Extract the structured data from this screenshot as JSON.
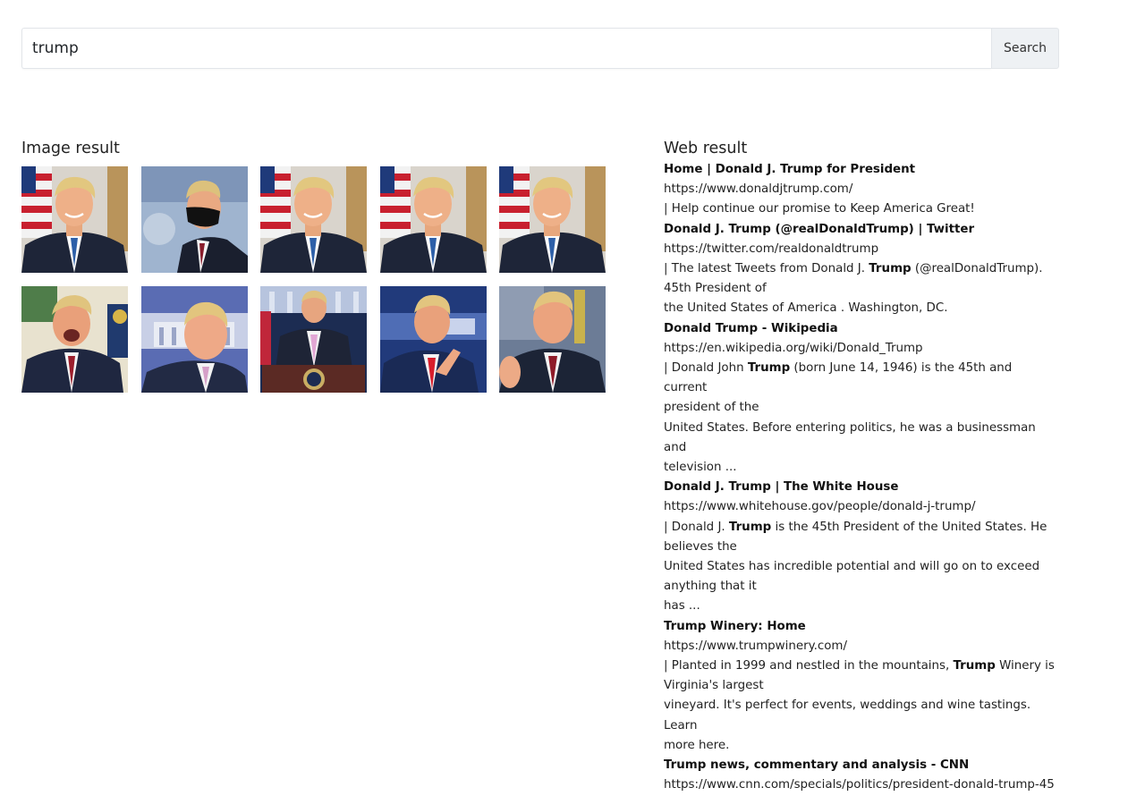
{
  "search": {
    "query": "trump",
    "button_label": "Search"
  },
  "images": {
    "title": "Image result",
    "thumbnails": [
      {
        "subject": "portrait-with-flag",
        "icon": "flag-portrait-icon"
      },
      {
        "subject": "wearing-face-mask",
        "icon": "masked-portrait-icon"
      },
      {
        "subject": "portrait-with-flag",
        "icon": "flag-portrait-icon"
      },
      {
        "subject": "portrait-with-flag",
        "icon": "flag-portrait-icon"
      },
      {
        "subject": "portrait-with-flag",
        "icon": "flag-portrait-icon"
      },
      {
        "subject": "speaking-outdoors",
        "icon": "speaker-portrait-icon"
      },
      {
        "subject": "white-house-background",
        "icon": "white-house-portrait-icon"
      },
      {
        "subject": "press-briefing-podium",
        "icon": "podium-portrait-icon"
      },
      {
        "subject": "pointing-at-briefing",
        "icon": "pointing-portrait-icon"
      },
      {
        "subject": "gesturing-at-briefing",
        "icon": "gesture-portrait-icon"
      }
    ]
  },
  "web": {
    "title": "Web result",
    "results": [
      {
        "title": "Home | Donald J. Trump for President",
        "url": "https://www.donaldjtrump.com/",
        "lines": [
          [
            {
              "t": "| Help continue our promise to Keep America Great!",
              "b": false
            }
          ]
        ]
      },
      {
        "title": "Donald J. Trump (@realDonaldTrump) | Twitter",
        "url": "https://twitter.com/realdonaldtrump",
        "lines": [
          [
            {
              "t": "| The latest Tweets from Donald J. ",
              "b": false
            },
            {
              "t": "Trump",
              "b": true
            },
            {
              "t": " (@realDonaldTrump).",
              "b": false
            }
          ],
          [
            {
              "t": "45th President of",
              "b": false
            }
          ],
          [
            {
              "t": "the United States of America . Washington, DC.",
              "b": false
            }
          ]
        ]
      },
      {
        "title": "Donald Trump - Wikipedia",
        "url": "https://en.wikipedia.org/wiki/Donald_Trump",
        "lines": [
          [
            {
              "t": "| Donald John ",
              "b": false
            },
            {
              "t": "Trump",
              "b": true
            },
            {
              "t": " (born June 14, 1946) is the 45th and current",
              "b": false
            }
          ],
          [
            {
              "t": "president of the",
              "b": false
            }
          ],
          [
            {
              "t": "United States. Before entering politics, he was a businessman and",
              "b": false
            }
          ],
          [
            {
              "t": "television ...",
              "b": false
            }
          ]
        ]
      },
      {
        "title": "Donald J. Trump | The White House",
        "url": "https://www.whitehouse.gov/people/donald-j-trump/",
        "lines": [
          [
            {
              "t": "| Donald J. ",
              "b": false
            },
            {
              "t": "Trump",
              "b": true
            },
            {
              "t": " is the 45th President of the United States. He",
              "b": false
            }
          ],
          [
            {
              "t": "believes the",
              "b": false
            }
          ],
          [
            {
              "t": "United States has incredible potential and will go on to exceed",
              "b": false
            }
          ],
          [
            {
              "t": "anything that it",
              "b": false
            }
          ],
          [
            {
              "t": "has ...",
              "b": false
            }
          ]
        ]
      },
      {
        "title": "Trump Winery: Home",
        "url": "https://www.trumpwinery.com/",
        "lines": [
          [
            {
              "t": "| Planted in 1999 and nestled in the mountains, ",
              "b": false
            },
            {
              "t": "Trump",
              "b": true
            },
            {
              "t": " Winery is",
              "b": false
            }
          ],
          [
            {
              "t": "Virginia's largest",
              "b": false
            }
          ],
          [
            {
              "t": "vineyard. It's perfect for events, weddings and wine tastings. Learn",
              "b": false
            }
          ],
          [
            {
              "t": "more here.",
              "b": false
            }
          ]
        ]
      },
      {
        "title": "Trump news, commentary and analysis - CNN",
        "url": "https://www.cnn.com/specials/politics/president-donald-trump-45",
        "lines": []
      }
    ]
  }
}
